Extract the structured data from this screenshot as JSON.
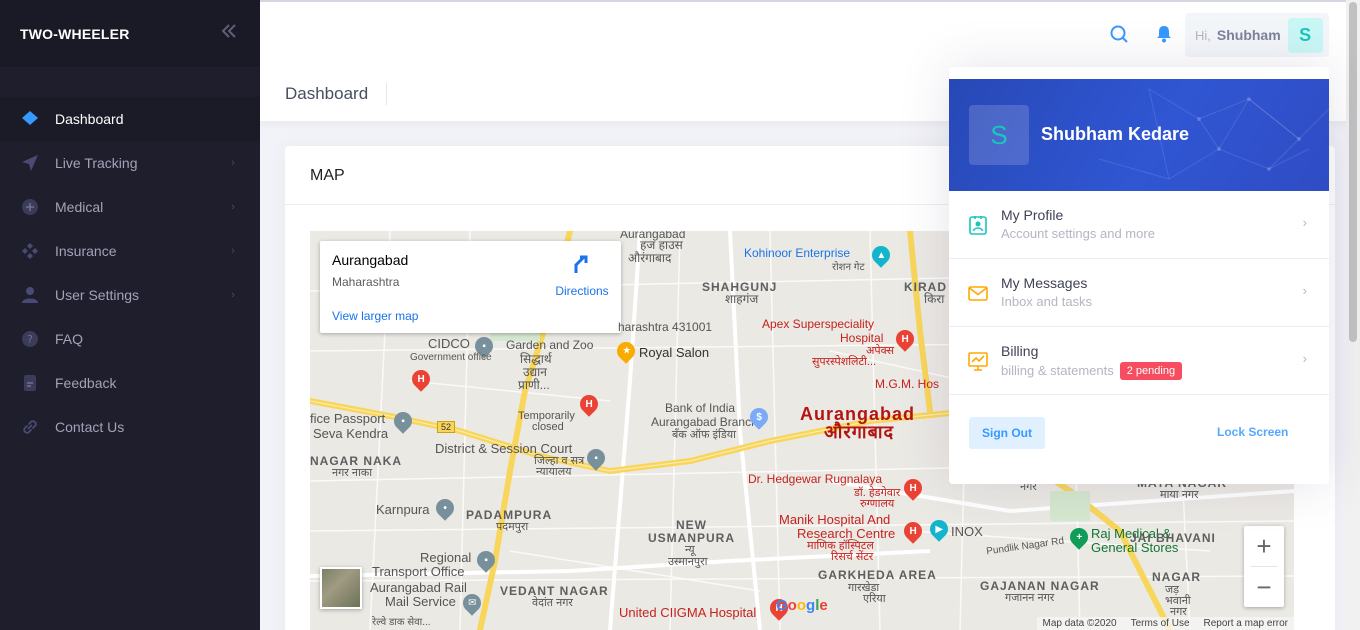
{
  "brand": "TWO-WHEELER",
  "colors": {
    "sidebar": "#1e1e2d",
    "accent": "#3699ff",
    "danger": "#f64e60",
    "avatar_bg": "#c9f7f5",
    "avatar_fg": "#1bc5bd"
  },
  "sidebar": {
    "items": [
      {
        "label": "Dashboard",
        "icon": "layers-icon",
        "active": true
      },
      {
        "label": "Live Tracking",
        "icon": "send-icon"
      },
      {
        "label": "Medical",
        "icon": "plus-circle-icon"
      },
      {
        "label": "Insurance",
        "icon": "diamonds-icon"
      },
      {
        "label": "User Settings",
        "icon": "user-icon"
      },
      {
        "label": "FAQ",
        "icon": "question-icon"
      },
      {
        "label": "Feedback",
        "icon": "document-icon"
      },
      {
        "label": "Contact Us",
        "icon": "link-icon"
      }
    ]
  },
  "topbar": {
    "greeting": "Hi,",
    "user_short": "Shubham",
    "initial": "S"
  },
  "subheader": {
    "title": "Dashboard"
  },
  "card": {
    "title": "MAP"
  },
  "map": {
    "place": "Aurangabad",
    "region": "Maharashtra",
    "directions": "Directions",
    "larger": "View larger map",
    "attribution": [
      "Map data ©2020",
      "Terms of Use",
      "Report a map error"
    ],
    "google": "Google",
    "labels": {
      "haj": "हज हाउस",
      "haj2": "औरंगाबाद",
      "aurangabad_top": "Aurangabad",
      "kohinoor": "Kohinoor Enterprise",
      "kohinoor2": "रोशन गेट",
      "shahgunj": "SHAHGUNJ",
      "shahgunj2": "शाहगंज",
      "kirad": "KIRAD",
      "kirad2": "किरा",
      "pin431001": "harashtra 431001",
      "apex": "Apex Superspeciality",
      "apex2": "Hospital",
      "apex3": "अपेक्स",
      "apex4": "सुपरस्पेशलिटी...",
      "cidco": "CIDCO",
      "govoffice": "Government office",
      "garden": "Garden and Zoo",
      "garden2": "सिद्धार्थ",
      "garden3": "उद्यान",
      "garden4": "प्राणी...",
      "royal": "Royal Salon",
      "mgm": "M.G.M. Hos",
      "passport": "fice Passport",
      "passport2": "Seva Kendra",
      "closed": "Temporarily",
      "closed2": "closed",
      "boi": "Bank of India",
      "boi2": "Aurangabad Branch",
      "boi3": "बँक ऑफ इंडिया",
      "city": "Aurangabad",
      "city2": "औरंगाबाद",
      "road52": "52",
      "nagar": "NAGAR NAKA",
      "nagar2": "नगर नाका",
      "court": "District & Session Court",
      "court2": "जिल्हा व सत्र",
      "court3": "न्यायालय",
      "hedgewar": "Dr. Hedgewar Rugnalaya",
      "hedgewar2": "डॉ. हेडगेवार",
      "hedgewar3": "रुग्णालय",
      "karnpura": "Karnpura",
      "padampura": "PADAMPURA",
      "padampura2": "पदमपुरा",
      "new": "NEW",
      "usmanpura": "USMANPURA",
      "usmanpura2": "न्यू",
      "usmanpura3": "उस्मानपुरा",
      "manik": "Manik Hospital And",
      "manik2": "Research Centre",
      "manik3": "माणिक हॉस्पिटल",
      "manik4": "रिसर्च सेंटर",
      "inox": "INOX",
      "pundlik": "Pundlik Nagar Rd",
      "raj": "Raj Medical &",
      "raj2": "General Stores",
      "rto": "Regional",
      "rto2": "Transport Office",
      "rail": "Aurangabad Rail",
      "rail2": "Mail Service",
      "rail3": "रेल्वे डाक सेवा...",
      "vedant": "VEDANT NAGAR",
      "vedant2": "वेदांत नगर",
      "garkheda": "GARKHEDA AREA",
      "garkheda2": "गारखेडा",
      "garkheda3": "एरिया",
      "gajanan": "GAJANAN NAGAR",
      "gajanan2": "गजानन नगर",
      "jai": "JAI BHAVANI",
      "jai2": "NAGAR",
      "jai3": "जड़",
      "jai4": "भवानी",
      "jai5": "नगर",
      "mayanagar": "MAYA NAGAR",
      "mayanagar2": "माया नगर",
      "nagar_r": "नगर",
      "ciigma": "United CIIGMA Hospital"
    }
  },
  "dropdown": {
    "name": "Shubham Kedare",
    "initial": "S",
    "items": [
      {
        "title": "My Profile",
        "sub": "Account settings and more",
        "icon": "profile-icon"
      },
      {
        "title": "My Messages",
        "sub": "Inbox and tasks",
        "icon": "mail-icon"
      },
      {
        "title": "Billing",
        "sub": "billing & statements",
        "badge": "2 pending",
        "icon": "chart-icon"
      }
    ],
    "sign_out": "Sign Out",
    "lock": "Lock Screen"
  }
}
